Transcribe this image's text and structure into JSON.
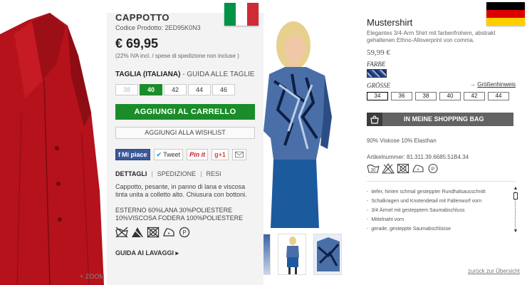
{
  "italian": {
    "title": "CAPPOTTO",
    "product_code": "Codice Prodotto: 2ED95K0N3",
    "price": "€ 69,95",
    "vat_note": "(22% IVA incl. / spese di spedizione non incluse )",
    "size_label": "TAGLIA (ITALIANA)",
    "size_guide": " - GUIDA ALLE TAGLIE",
    "sizes": [
      "38",
      "40",
      "42",
      "44",
      "46"
    ],
    "selected_size": "40",
    "add_to_cart": "AGGIUNGI AL CARRELLO",
    "add_to_wishlist": "AGGIUNGI ALLA WISHLIST",
    "social": {
      "facebook": "Mi piace",
      "tweet": "Tweet",
      "pinit": "Pin it",
      "gplus": "g+1"
    },
    "tabs": [
      "DETTAGLI",
      "SPEDIZIONE",
      "RESI"
    ],
    "description": "Cappotto, pesante, in panno di lana e viscosa tinta unita a colletto alto. Chiusura con bottoni.",
    "composition": "ESTERNO 60%LANA 30%POLIESTERE 10%VISCOSA FODERA 100%POLIESTERE",
    "care_guide": "GUIDA AI LAVAGGI",
    "zoom": "+ ZOOM",
    "colors": {
      "coat": "#b5121b",
      "accent_green": "#1b8c2a",
      "panel_bg": "#f3f3f3"
    }
  },
  "german": {
    "title": "Mustershirt",
    "description": "Elegantes 3/4-Arm Shirt mit farbenfrohem, abstrakt gehaltenen Ethno-Alloverprint von comma.",
    "price": "59,99 €",
    "color_label": "FARBE",
    "size_label": "GRÖSSE",
    "size_guide": "Größenhinweis",
    "sizes": [
      "34",
      "36",
      "38",
      "40",
      "42",
      "44"
    ],
    "selected_size": "34",
    "bag_button": "IN MEINE SHOPPING BAG",
    "material": "90% Viskose 10% Elasthan",
    "article_number": "Artikelnummer: 81.311.39.6685.51B4.34",
    "features": [
      "tiefer, hinten schmal gesteppter Rundhalsausschnitt",
      "Schalkragen und Knotendetail mit Faltenwurf vorn",
      "3/4 Ärmel mit gestepptem Saumabschluss",
      "Mittelnaht vorn",
      "gerade, gesteppte Saumabschlüsse"
    ],
    "back_link": "zurück zur Übersicht",
    "colors": {
      "skirt": "#1c5a9e",
      "bag_button": "#636363"
    }
  }
}
